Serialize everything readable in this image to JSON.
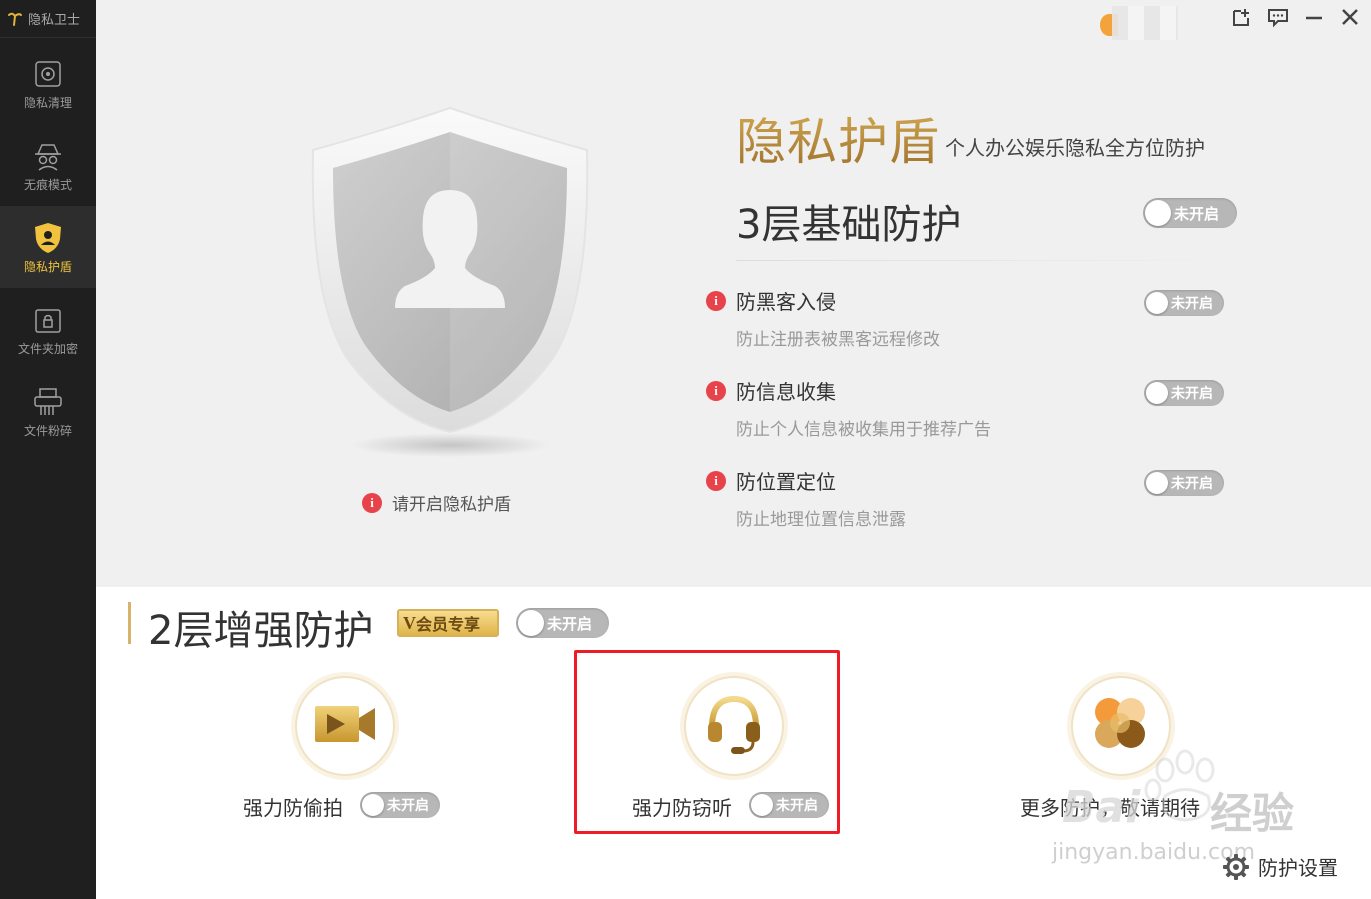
{
  "app": {
    "title": "隐私卫士"
  },
  "sidebar": {
    "items": [
      {
        "label": "隐私清理",
        "icon": "privacy-clean-icon"
      },
      {
        "label": "无痕模式",
        "icon": "incognito-icon"
      },
      {
        "label": "隐私护盾",
        "icon": "shield-user-icon"
      },
      {
        "label": "文件夹加密",
        "icon": "folder-lock-icon"
      },
      {
        "label": "文件粉碎",
        "icon": "shredder-icon"
      }
    ],
    "active_index": 2
  },
  "window": {
    "controls": [
      "export-icon",
      "feedback-icon",
      "minimize-icon",
      "close-icon"
    ]
  },
  "shield": {
    "hint": "请开启隐私护盾"
  },
  "hero": {
    "title": "隐私护盾",
    "subtitle": "个人办公娱乐隐私全方位防护"
  },
  "basic": {
    "title": "3层基础防护",
    "toggle_label": "未开启",
    "items": [
      {
        "name": "防黑客入侵",
        "desc": "防止注册表被黑客远程修改",
        "toggle": "未开启"
      },
      {
        "name": "防信息收集",
        "desc": "防止个人信息被收集用于推荐广告",
        "toggle": "未开启"
      },
      {
        "name": "防位置定位",
        "desc": "防止地理位置信息泄露",
        "toggle": "未开启"
      }
    ]
  },
  "enhanced": {
    "title": "2层增强防护",
    "vip_badge_v": "V",
    "vip_badge_text": "会员专享",
    "toggle_label": "未开启",
    "features": [
      {
        "label": "强力防偷拍",
        "toggle": "未开启",
        "icon": "camera-icon"
      },
      {
        "label": "强力防窃听",
        "toggle": "未开启",
        "icon": "headset-icon"
      },
      {
        "label": "更多防护，敬请期待",
        "icon": "more-protection-icon"
      }
    ]
  },
  "settings": {
    "label": "防护设置"
  },
  "watermark": {
    "brand": "Bai",
    "text": "经验",
    "url": "jingyan.baidu.com"
  },
  "colors": {
    "accent_gold": "#d9b36b",
    "alert_red": "#e8424b",
    "highlight_red": "#ee1c25",
    "sidebar_bg": "#1f1f1f"
  }
}
